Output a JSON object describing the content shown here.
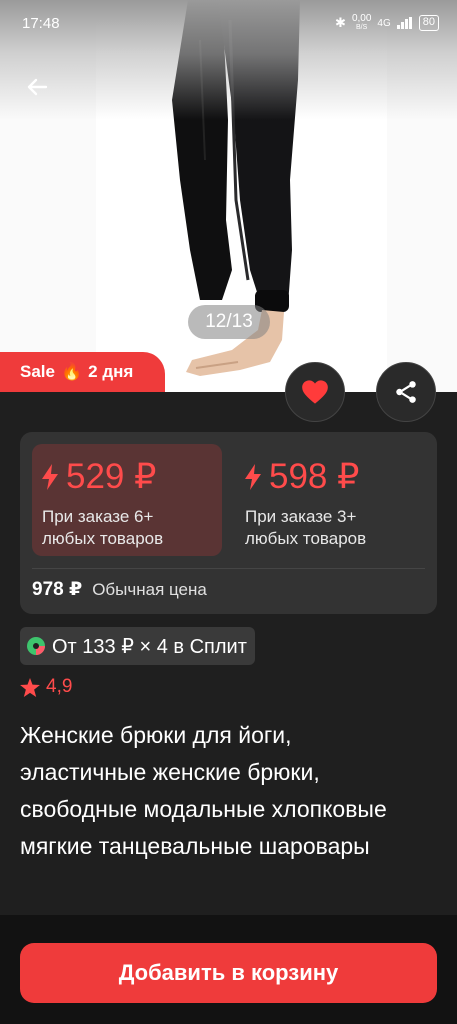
{
  "status": {
    "time": "17:48",
    "net_speed": "0,00",
    "net_unit": "B/S",
    "network": "4G",
    "battery": "80"
  },
  "gallery": {
    "counter": "12/13"
  },
  "sale": {
    "label": "Sale",
    "emoji": "🔥",
    "duration": "2 дня"
  },
  "prices": {
    "tiers": [
      {
        "price": "529 ₽",
        "condition_line1": "При заказе 6+",
        "condition_line2": "любых товаров"
      },
      {
        "price": "598 ₽",
        "condition_line1": "При заказе 3+",
        "condition_line2": "любых товаров"
      }
    ],
    "regular_price": "978 ₽",
    "regular_label": "Обычная цена"
  },
  "split": {
    "text": "От 133 ₽ × 4 в Сплит"
  },
  "rating": {
    "value": "4,9"
  },
  "product": {
    "title": "Женские брюки для йоги, эластичные женские брюки, свободные модальные хлопковые мягкие танцевальные шаровары"
  },
  "actions": {
    "add_to_cart": "Добавить в корзину"
  },
  "colors": {
    "accent": "#ef3b3b",
    "price_red": "#ff4b4b",
    "background": "#1f1f1f",
    "card": "#333333"
  }
}
